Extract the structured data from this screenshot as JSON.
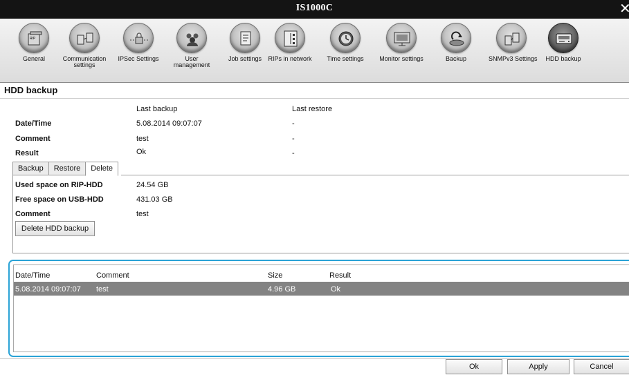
{
  "window": {
    "title": "IS1000C"
  },
  "toolbar": {
    "items": [
      {
        "label": "General",
        "icon": "rip-server-icon"
      },
      {
        "label": "Communication settings",
        "icon": "communication-icon"
      },
      {
        "label": "IPSec Settings",
        "icon": "ipsec-lock-icon"
      },
      {
        "label": "User management",
        "icon": "users-icon"
      },
      {
        "label": "Job settings",
        "icon": "job-document-icon"
      },
      {
        "label": "RIPs in network",
        "icon": "network-icon"
      },
      {
        "label": "Time settings",
        "icon": "clock-icon"
      },
      {
        "label": "Monitor settings",
        "icon": "monitor-icon"
      },
      {
        "label": "Backup",
        "icon": "backup-icon"
      },
      {
        "label": "SNMPv3 Settings",
        "icon": "snmp-icon"
      },
      {
        "label": "HDD backup",
        "icon": "hdd-icon"
      }
    ],
    "active": "HDD backup"
  },
  "page": {
    "title": "HDD backup"
  },
  "summary": {
    "col_last_backup": "Last backup",
    "col_last_restore": "Last restore",
    "rows": [
      {
        "label": "Date/Time",
        "backup": "5.08.2014 09:07:07",
        "restore": "-"
      },
      {
        "label": "Comment",
        "backup": "test",
        "restore": "-"
      },
      {
        "label": "Result",
        "backup": "Ok",
        "restore": "-"
      }
    ]
  },
  "tabs": [
    {
      "label": "Backup"
    },
    {
      "label": "Restore"
    },
    {
      "label": "Delete"
    }
  ],
  "active_tab": "Delete",
  "delete_panel": {
    "used_label": "Used space on RIP-HDD",
    "used_value": "24.54 GB",
    "free_label": "Free space on USB-HDD",
    "free_value": "431.03 GB",
    "comment_label": "Comment",
    "comment_value": "test",
    "delete_button": "Delete HDD backup"
  },
  "history": {
    "columns": [
      "Date/Time",
      "Comment",
      "Size",
      "Result"
    ],
    "rows": [
      {
        "datetime": "5.08.2014 09:07:07",
        "comment": "test",
        "size": "4.96 GB",
        "result": "Ok"
      }
    ]
  },
  "footer": {
    "ok": "Ok",
    "apply": "Apply",
    "cancel": "Cancel"
  },
  "colors": {
    "selection": "#838383",
    "highlight_border": "#2aa3d6",
    "titlebar": "#141414"
  }
}
